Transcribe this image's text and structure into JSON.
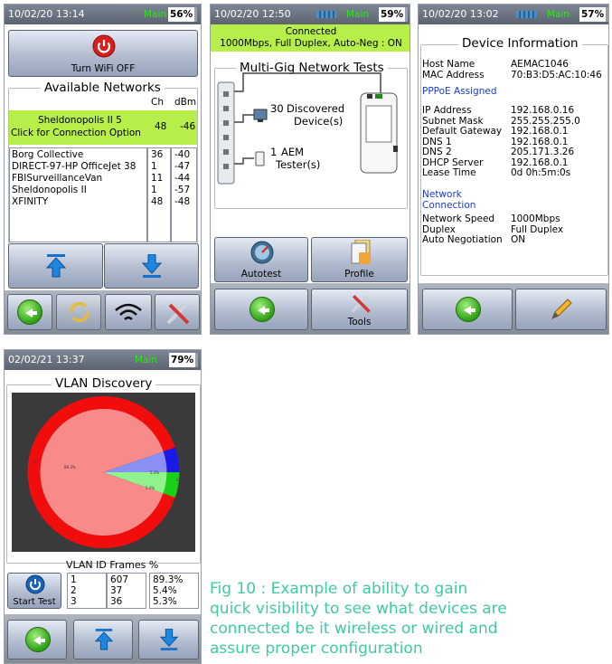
{
  "screen1": {
    "status": {
      "time": "10/02/20 13:14",
      "mode": "Main",
      "battery": "56%"
    },
    "wifi_off_label": "Turn WiFi OFF",
    "section_title": "Available Networks",
    "col_ch": "Ch",
    "col_dbm": "dBm",
    "selected": {
      "name": "Sheldonopolis II 5",
      "hint": "Click for Connection Option",
      "ch": "48",
      "dbm": "-46"
    },
    "networks": [
      {
        "name": "Borg Collective",
        "ch": "36",
        "dbm": "-40"
      },
      {
        "name": "DIRECT-97-HP OfficeJet 38",
        "ch": "1",
        "dbm": "-47"
      },
      {
        "name": "FBISurveillanceVan",
        "ch": "11",
        "dbm": "-44"
      },
      {
        "name": "Sheldonopolis II",
        "ch": "1",
        "dbm": "-57"
      },
      {
        "name": "XFINITY",
        "ch": "48",
        "dbm": "-48"
      }
    ]
  },
  "screen2": {
    "status": {
      "time": "10/02/20 12:50",
      "mode": "Main",
      "battery": "59%"
    },
    "connected_title": "Connected",
    "connected_detail": "1000Mbps, Full Duplex, Auto-Neg : ON",
    "section_title": "Multi-Gig Network Tests",
    "discovered_count": "30",
    "discovered_label": "Discovered",
    "discovered_label2": "Device(s)",
    "tester_count": "1",
    "tester_label": "AEM",
    "tester_label2": "Tester(s)",
    "autotest_label": "Autotest",
    "profile_label": "Profile",
    "tools_label": "Tools"
  },
  "screen3": {
    "status": {
      "time": "10/02/20 13:02",
      "mode": "Main",
      "battery": "57%"
    },
    "section_title": "Device Information",
    "rows1": [
      {
        "key": "Host Name",
        "value": "AEMAC1046"
      },
      {
        "key": "MAC Address",
        "value": "70:B3:D5:AC:10:46"
      }
    ],
    "pppoe": "PPPoE Assigned",
    "rows2": [
      {
        "key": "IP Address",
        "value": "192.168.0.16"
      },
      {
        "key": "Subnet Mask",
        "value": "255.255.255.0"
      },
      {
        "key": "Default Gateway",
        "value": "192.168.0.1"
      },
      {
        "key": "DNS 1",
        "value": "192.168.0.1"
      },
      {
        "key": "DNS 2",
        "value": "205.171.3.26"
      },
      {
        "key": "DHCP Server",
        "value": "192.168.0.1"
      },
      {
        "key": "Lease Time",
        "value": "0d 0h:5m:0s"
      }
    ],
    "network_connection": "Network",
    "network_connection2": "Connection",
    "rows3": [
      {
        "key": "Network Speed",
        "value": "1000Mbps"
      },
      {
        "key": "Duplex",
        "value": "Full Duplex"
      },
      {
        "key": "Auto Negotiation",
        "value": "ON"
      }
    ]
  },
  "screen4": {
    "status": {
      "time": "02/02/21 13:37",
      "mode": "Main",
      "battery": "79%"
    },
    "section_title": "VLAN Discovery",
    "table_header": "VLAN ID Frames  %",
    "start_test_label": "Start Test",
    "rows": [
      {
        "id": "1",
        "frames": "607",
        "pct": "89.3%"
      },
      {
        "id": "2",
        "frames": "37",
        "pct": "5.4%"
      },
      {
        "id": "3",
        "frames": "36",
        "pct": "5.3%"
      }
    ],
    "pie_labels": {
      "a": "89.3%",
      "b": "5.3%",
      "c": "5.4%",
      "n1": "1",
      "n2": "2",
      "n3": "3"
    },
    "pie_colors": {
      "slice1": "#f88a8a",
      "slice2": "#8ff28b",
      "slice3": "#8a8ff3",
      "ring1": "#f20d0d",
      "ring2": "#18d018",
      "ring3": "#1a1ae8"
    }
  },
  "caption": {
    "line1": "Fig 10 : Example of ability to gain",
    "line2": "quick visibility to see what devices are",
    "line3": "connected be it wireless or wired and",
    "line4": "assure proper configuration"
  }
}
